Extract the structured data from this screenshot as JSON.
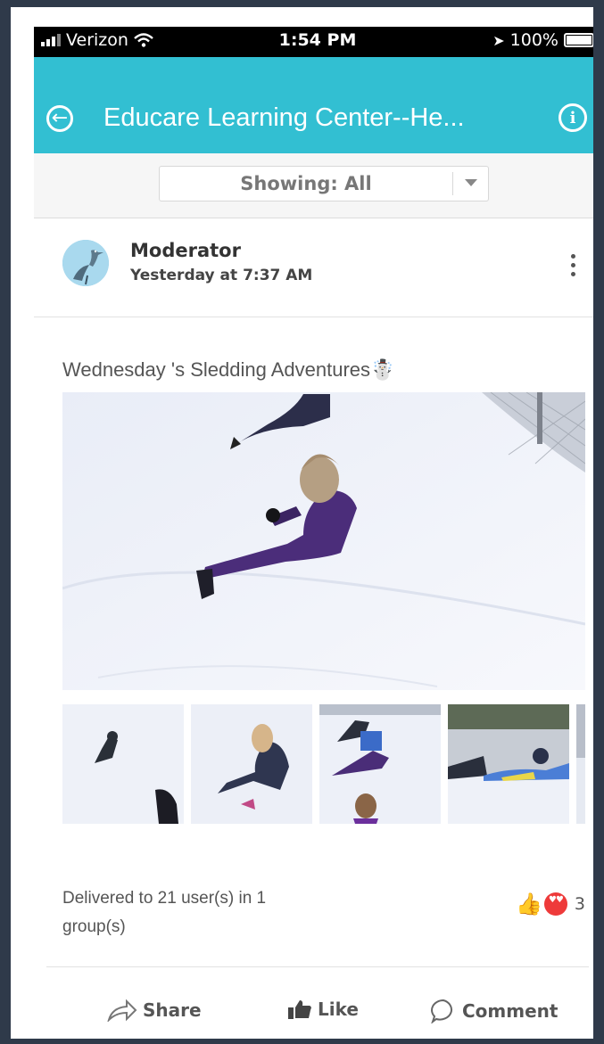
{
  "status_bar": {
    "carrier": "Verizon",
    "time": "1:54 PM",
    "battery": "100%"
  },
  "header": {
    "title": "Educare Learning Center--He..."
  },
  "filter": {
    "label": "Showing: All"
  },
  "post": {
    "author": "Moderator",
    "time": "Yesterday at 7:37 AM",
    "title": "Wednesday 's Sledding Adventures☃️",
    "delivered_line1": "Delivered to 21 user(s) in 1",
    "delivered_line2": "group(s)",
    "reaction_count": "3",
    "thumbnail_count": 5
  },
  "actions": {
    "share": "Share",
    "like": "Like",
    "comment": "Comment"
  },
  "colors": {
    "header_bg": "#32bfd2",
    "status_bg": "#000000",
    "text_primary": "#333333",
    "text_secondary": "#555555"
  }
}
